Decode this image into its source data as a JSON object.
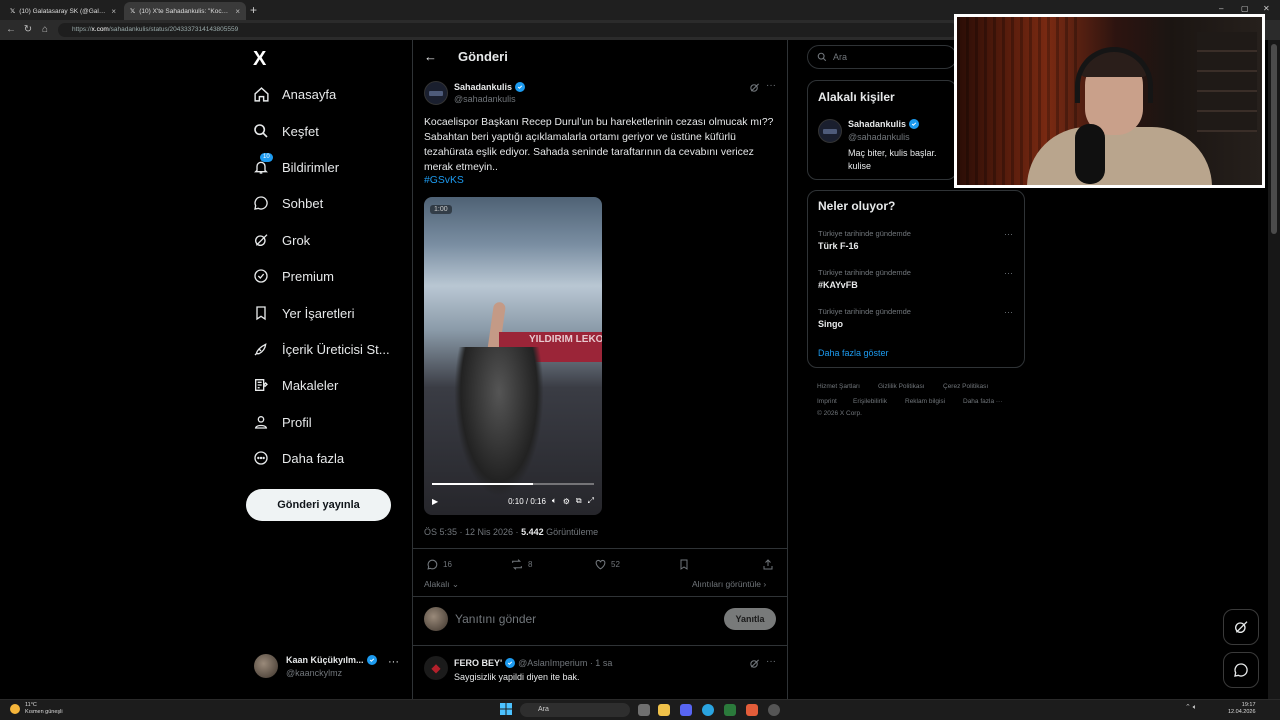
{
  "browser": {
    "tabs": [
      {
        "label": "(10) Galatasaray SK (@Galatasaray",
        "close": "×"
      },
      {
        "label": "(10) X'te Sahadankulis: \"Kocaelisp",
        "close": "×"
      }
    ],
    "new_tab": "+",
    "url_host": "x.com",
    "url_prefix": "https://",
    "url_path": "/sahadankulis/status/2043337314143805559",
    "window_controls": [
      "–",
      "▢",
      "✕"
    ]
  },
  "nav": {
    "logo": "X",
    "items": [
      {
        "label": "Anasayfa",
        "icon": "home-icon"
      },
      {
        "label": "Keşfet",
        "icon": "search-icon"
      },
      {
        "label": "Bildirimler",
        "icon": "bell-icon",
        "badge": "10"
      },
      {
        "label": "Sohbet",
        "icon": "chat-icon"
      },
      {
        "label": "Grok",
        "icon": "grok-icon"
      },
      {
        "label": "Premium",
        "icon": "premium-icon"
      },
      {
        "label": "Yer İşaretleri",
        "icon": "bookmark-icon"
      },
      {
        "label": "İçerik Üreticisi St...",
        "icon": "rocket-icon"
      },
      {
        "label": "Makaleler",
        "icon": "articles-icon"
      },
      {
        "label": "Profil",
        "icon": "profile-icon"
      },
      {
        "label": "Daha fazla",
        "icon": "more-circle-icon"
      }
    ],
    "post_button": "Gönderi yayınla",
    "account": {
      "name": "Kaan Küçükyılm...",
      "handle": "@kaanckylmz",
      "more": "···"
    }
  },
  "post": {
    "header_title": "Gönderi",
    "author_name": "Sahadankulis",
    "author_handle": "@sahadankulis",
    "text": "Kocaelispor Başkanı Recep Durul’un bu hareketlerinin cezası olmucak mı??Sabahtan beri yaptığı açıklamalarla ortamı geriyor ve üstüne küfürlü tezahürata eşlik ediyor. Sahada seninde taraftarının da cevabını vericez merak etmeyin..",
    "hashtag": "#GSvKS",
    "video": {
      "badge": "1:00",
      "time": "0:10 / 0:16",
      "progress": 0.625,
      "banner_text": "YILDIRIM LEKO"
    },
    "time": "ÖS 5:35 · 12 Nis 2026 · ",
    "views": "5.442",
    "views_label": " Görüntüleme",
    "replies": "16",
    "reposts": "8",
    "likes": "52",
    "related_label": "Alakalı",
    "quotes_label": "Alıntıları görüntüle",
    "reply_placeholder": "Yanıtını gönder",
    "reply_button": "Yanıtla"
  },
  "comment": {
    "name": "FERO BEY'",
    "handle": "@AslanImperium · 1 sa",
    "text": "Saygisizlik yapildi diyen ite bak."
  },
  "sidebar": {
    "search_placeholder": "Ara",
    "people_title": "Alakalı kişiler",
    "person": {
      "name": "Sahadankulis",
      "handle": "@sahadankulis",
      "bio": "Maç biter, kulis başlar. kulise"
    },
    "trends_title": "Neler oluyor?",
    "trends": [
      {
        "context": "Türkiye tarihinde gündemde",
        "name": "Türk F-16"
      },
      {
        "context": "Türkiye tarihinde gündemde",
        "name": "#KAYvFB"
      },
      {
        "context": "Türkiye tarihinde gündemde",
        "name": "Singo"
      }
    ],
    "show_more": "Daha fazla göster",
    "footer": [
      "Hizmet Şartları",
      "Gizlilik Politikası",
      "Çerez Politikası",
      "Imprint",
      "Erişilebilirlik",
      "Reklam bilgisi",
      "Daha fazla ···",
      "© 2026 X Corp."
    ]
  },
  "taskbar": {
    "weather_temp": "11°C",
    "weather_desc": "Kısmen güneşli",
    "search": "Ara",
    "time": "19:17",
    "date": "12.04.2026"
  },
  "colors": {
    "accent": "#1d9bf0",
    "background": "#000000",
    "border": "#2f3336",
    "muted": "#71767b"
  }
}
